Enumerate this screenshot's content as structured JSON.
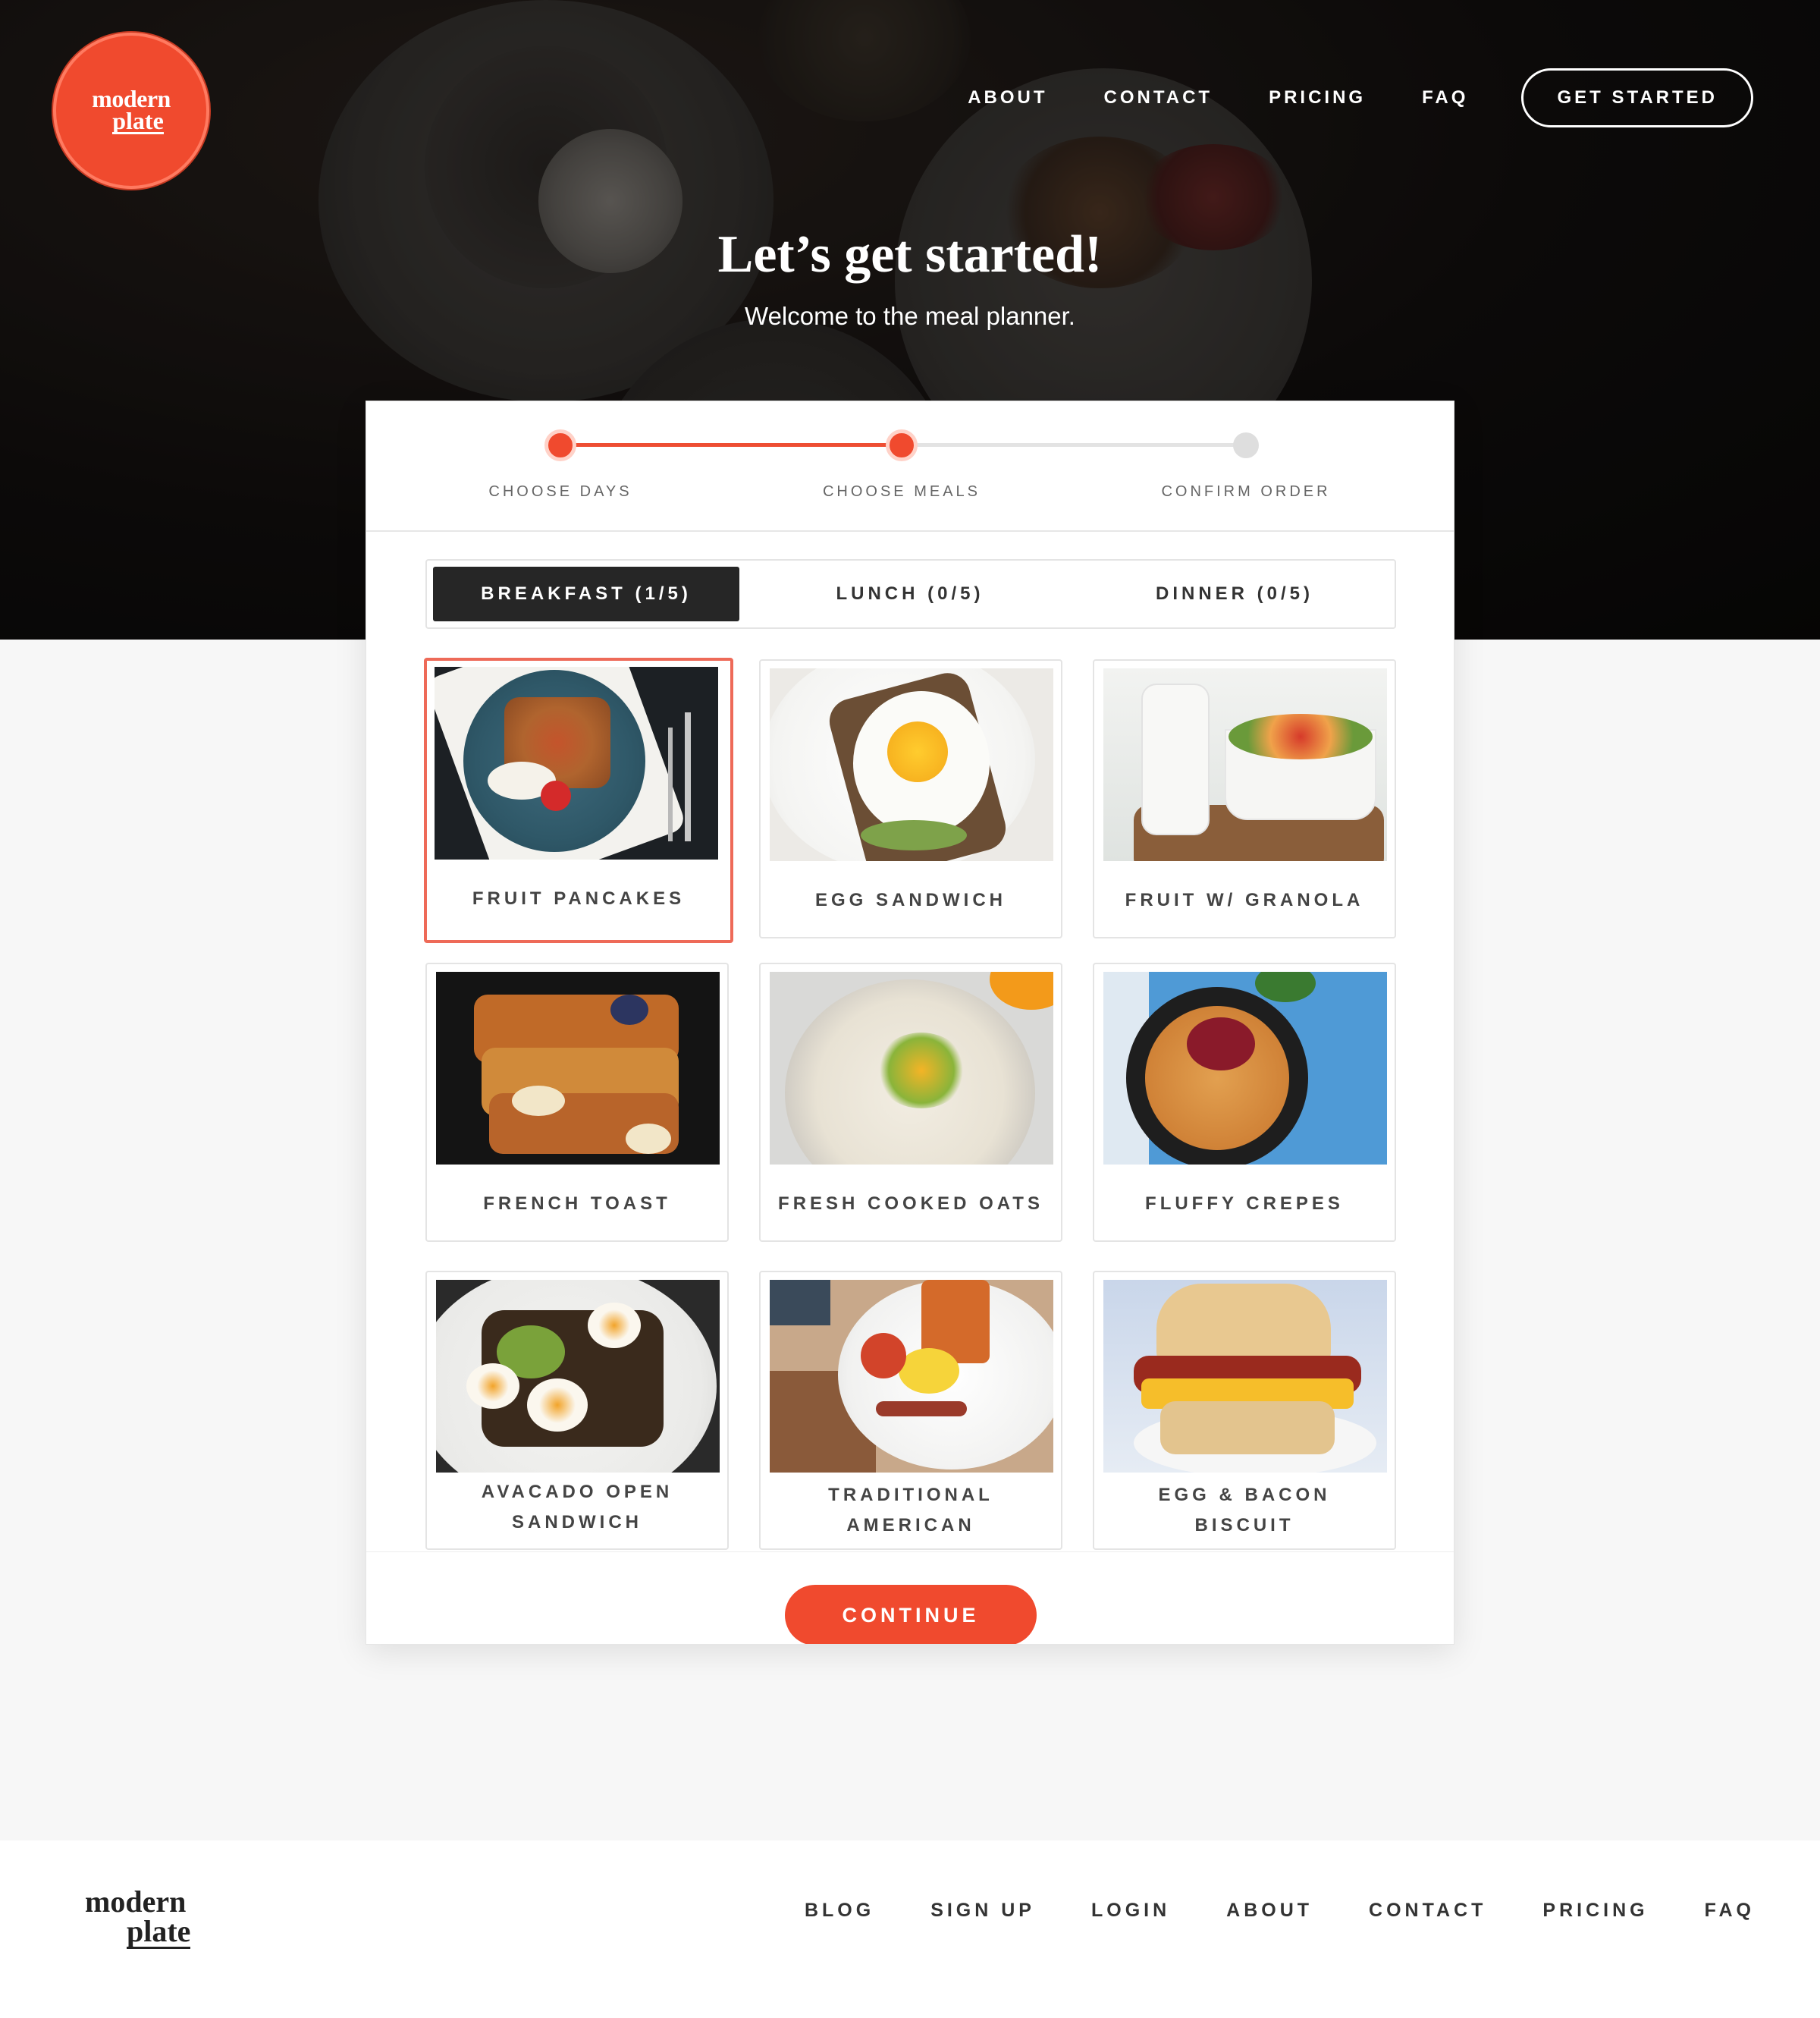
{
  "brand": {
    "logo_line1": "modern",
    "logo_line2": "plate",
    "accent": "#f04a2e"
  },
  "nav": {
    "items": [
      "ABOUT",
      "CONTACT",
      "PRICING",
      "FAQ"
    ],
    "cta": "GET STARTED"
  },
  "hero": {
    "title": "Let’s get started!",
    "subtitle": "Welcome to the meal planner."
  },
  "steps": [
    {
      "label": "CHOOSE DAYS",
      "state": "complete"
    },
    {
      "label": "CHOOSE MEALS",
      "state": "current"
    },
    {
      "label": "CONFIRM ORDER",
      "state": "upcoming"
    }
  ],
  "tabs": [
    {
      "label": "BREAKFAST (1/5)",
      "active": true
    },
    {
      "label": "LUNCH (0/5)",
      "active": false
    },
    {
      "label": "DINNER (0/5)",
      "active": false
    }
  ],
  "meals": [
    {
      "name": "FRUIT PANCAKES",
      "selected": true
    },
    {
      "name": "EGG SANDWICH",
      "selected": false
    },
    {
      "name": "FRUIT W/ GRANOLA",
      "selected": false
    },
    {
      "name": "FRENCH TOAST",
      "selected": false
    },
    {
      "name": "FRESH COOKED OATS",
      "selected": false
    },
    {
      "name": "FLUFFY CREPES",
      "selected": false
    },
    {
      "name_line1": "AVACADO OPEN",
      "name_line2": "SANDWICH",
      "selected": false
    },
    {
      "name_line1": "TRADITIONAL",
      "name_line2": "AMERICAN",
      "selected": false
    },
    {
      "name_line1": "EGG & BACON",
      "name_line2": "BISCUIT",
      "selected": false
    }
  ],
  "continue_label": "CONTINUE",
  "footer": {
    "logo_line1": "modern",
    "logo_line2": "plate",
    "links": [
      "BLOG",
      "SIGN UP",
      "LOGIN",
      "ABOUT",
      "CONTACT",
      "PRICING",
      "FAQ"
    ]
  }
}
